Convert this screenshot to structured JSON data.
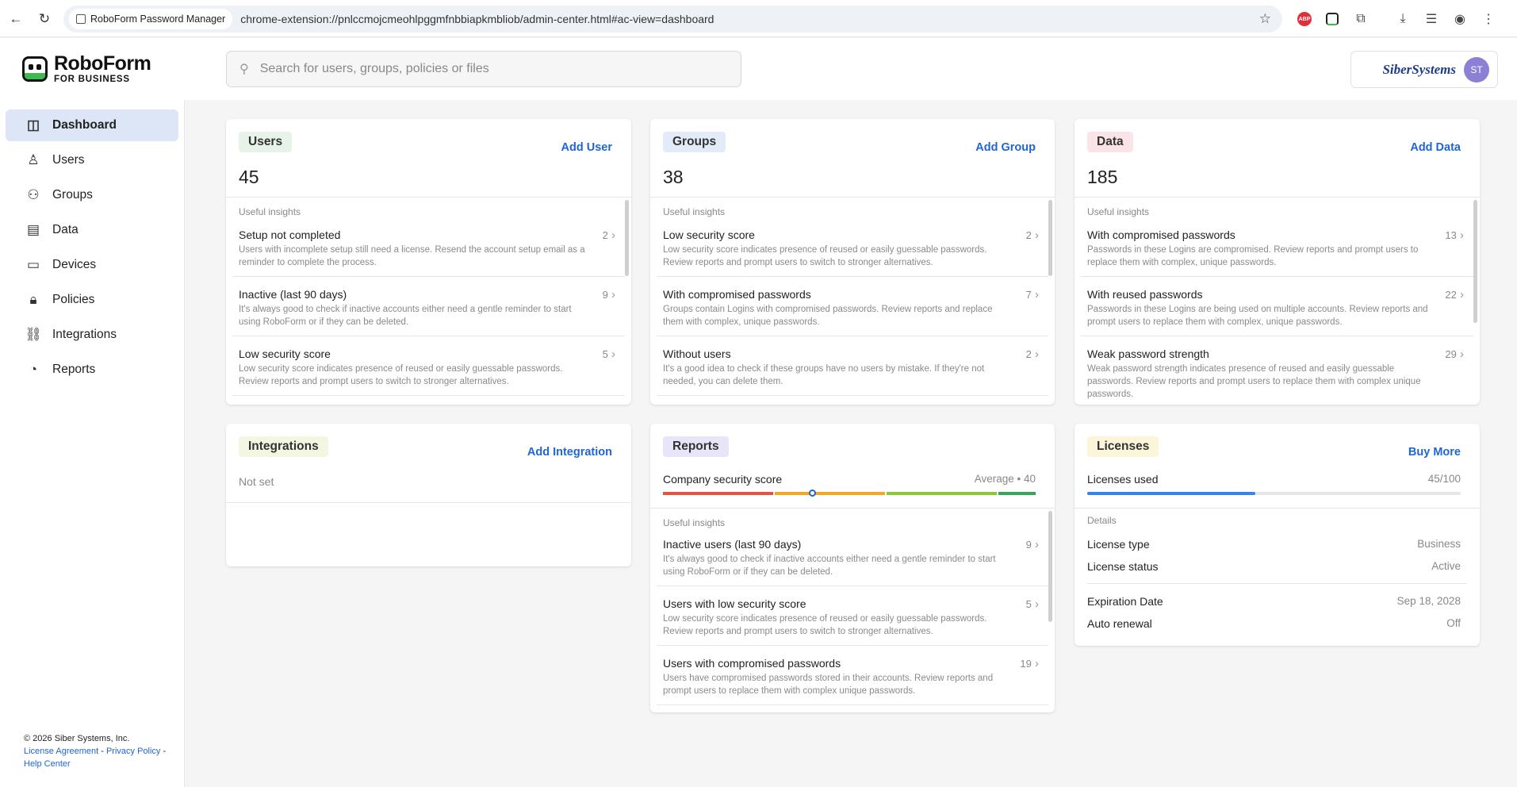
{
  "browser": {
    "tab_chip": "RoboForm Password Manager",
    "url": "chrome-extension://pnlccmojcmeohlpggmfnbbiapkmbliob/admin-center.html#ac-view=dashboard",
    "abp_label": "ABP"
  },
  "header": {
    "logo_line1": "RoboForm",
    "logo_line2": "FOR BUSINESS",
    "search_placeholder": "Search for users, groups, policies or files",
    "company_name": "SiberSystems",
    "avatar_initials": "ST"
  },
  "sidebar": {
    "items": [
      {
        "label": "Dashboard",
        "icon": "dashboard-icon",
        "active": true
      },
      {
        "label": "Users",
        "icon": "user-icon"
      },
      {
        "label": "Groups",
        "icon": "groups-icon"
      },
      {
        "label": "Data",
        "icon": "file-icon"
      },
      {
        "label": "Devices",
        "icon": "monitor-icon"
      },
      {
        "label": "Policies",
        "icon": "lock-icon"
      },
      {
        "label": "Integrations",
        "icon": "link-icon"
      },
      {
        "label": "Reports",
        "icon": "chart-icon"
      }
    ],
    "footer": {
      "copyright": "© 2026 Siber Systems, Inc.",
      "license": "License Agreement",
      "sep1": " - ",
      "privacy": "Privacy Policy",
      "sep2": " -",
      "help": "Help Center"
    }
  },
  "cards": {
    "users": {
      "title": "Users",
      "action": "Add User",
      "count": "45",
      "insights_label": "Useful insights",
      "insights": [
        {
          "title": "Setup not completed",
          "count": "2",
          "desc": "Users with incomplete setup still need a license. Resend the account setup email as a reminder to complete the process."
        },
        {
          "title": "Inactive (last 90 days)",
          "count": "9",
          "desc": "It's always good to check if inactive accounts either need a gentle reminder to start using RoboForm or if they can be deleted."
        },
        {
          "title": "Low security score",
          "count": "5",
          "desc": "Low security score indicates presence of reused or easily guessable passwords. Review reports and prompt users to switch to stronger alternatives."
        }
      ]
    },
    "groups": {
      "title": "Groups",
      "action": "Add Group",
      "count": "38",
      "insights_label": "Useful insights",
      "insights": [
        {
          "title": "Low security score",
          "count": "2",
          "desc": "Low security score indicates presence of reused or easily guessable passwords. Review reports and prompt users to switch to stronger alternatives."
        },
        {
          "title": "With compromised passwords",
          "count": "7",
          "desc": "Groups contain Logins with compromised passwords. Review reports and replace them with complex, unique passwords."
        },
        {
          "title": "Without users",
          "count": "2",
          "desc": "It's a good idea to check if these groups have no users by mistake. If they're not needed, you can delete them."
        }
      ]
    },
    "data": {
      "title": "Data",
      "action": "Add Data",
      "count": "185",
      "insights_label": "Useful insights",
      "insights": [
        {
          "title": "With compromised passwords",
          "count": "13",
          "desc": "Passwords in these Logins are compromised. Review reports and prompt users to replace them with complex, unique passwords."
        },
        {
          "title": "With reused passwords",
          "count": "22",
          "desc": "Passwords in these Logins are being used on multiple accounts. Review reports and prompt users to replace them with complex, unique passwords."
        },
        {
          "title": "Weak password strength",
          "count": "29",
          "desc": "Weak password strength indicates presence of reused and easily guessable passwords. Review reports and prompt users to replace them with complex unique passwords."
        }
      ]
    },
    "integrations": {
      "title": "Integrations",
      "action": "Add Integration",
      "status": "Not set"
    },
    "reports": {
      "title": "Reports",
      "score_label": "Company security score",
      "score_text": "Average • 40",
      "score_value": 40,
      "insights_label": "Useful insights",
      "insights": [
        {
          "title": "Inactive users (last 90 days)",
          "count": "9",
          "desc": "It's always good to check if inactive accounts either need a gentle reminder to start using RoboForm or if they can be deleted."
        },
        {
          "title": "Users with low security score",
          "count": "5",
          "desc": "Low security score indicates presence of reused or easily guessable passwords. Review reports and prompt users to switch to stronger alternatives."
        },
        {
          "title": "Users with compromised passwords",
          "count": "19",
          "desc": "Users have compromised passwords stored in their accounts. Review reports and prompt users to replace them with complex unique passwords."
        }
      ]
    },
    "licenses": {
      "title": "Licenses",
      "action": "Buy More",
      "used_label": "Licenses used",
      "used_text": "45/100",
      "used_fraction": 0.45,
      "details_label": "Details",
      "type_label": "License type",
      "type_value": "Business",
      "status_label": "License status",
      "status_value": "Active",
      "expiration_label": "Expiration Date",
      "expiration_value": "Sep 18, 2028",
      "renewal_label": "Auto renewal",
      "renewal_value": "Off"
    }
  },
  "colors": {
    "accent": "#2066d3",
    "users_badge": "#e7f3e9",
    "groups_badge": "#e3ebf8",
    "data_badge": "#fbe4e7",
    "integrations_badge": "#f3f6e0",
    "reports_badge": "#e9e5f8",
    "licenses_badge": "#fbf5da"
  }
}
